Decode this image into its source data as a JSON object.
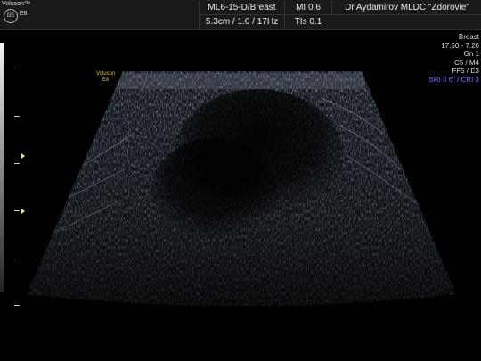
{
  "header": {
    "brand": "Voluson™",
    "model": "E8",
    "logo_text": "GE",
    "probe_preset": "ML6-15-D/Breast",
    "mi": "MI  0.6",
    "clinic": "Dr Aydamirov MLDC \"Zdorovie\"",
    "depth_info": "5.3cm / 1.0 / 17Hz",
    "tis": "TIs  0.1"
  },
  "probe_label": {
    "line1": "Voluson",
    "line2": "E8"
  },
  "side_panel": {
    "preset": "Breast",
    "freq": "17.50 - 7.20",
    "gain": "Gn  1",
    "c": "C5 / M4",
    "ff": "FF5 / E3",
    "sri": "SRI II 6\" / CRI 3"
  },
  "colors": {
    "header_bg": "#1a1a1a",
    "accent_blue": "#6b6bff",
    "probe_label": "#e0c040"
  }
}
